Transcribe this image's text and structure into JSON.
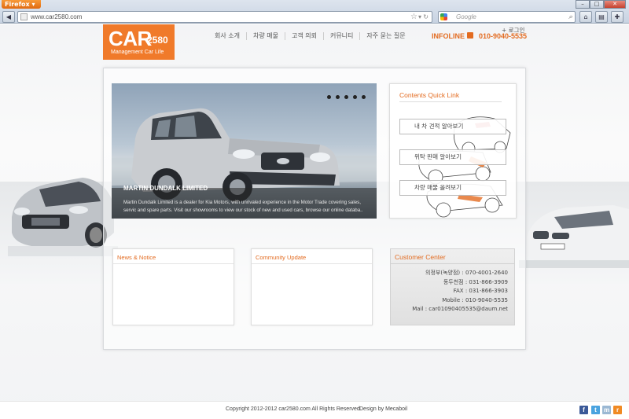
{
  "browser": {
    "app_button": "Firefox",
    "url": "www.car2580.com",
    "search_placeholder": "Google"
  },
  "header": {
    "logo_main": "CAR",
    "logo_num": "2580",
    "logo_sub": "Management Car Life",
    "login": "+ 로그인",
    "nav": [
      "회사 소개",
      "차량 매물",
      "고객 의뢰",
      "커뮤니티",
      "자주 묻는 질문"
    ],
    "infoline_label": "INFOLINE",
    "infoline_phone": "010-9040-5535"
  },
  "hero": {
    "title": "MARTIN DUNDALK LIMITED",
    "text": "Martin Dundalk Limited is a dealer for Kia Motors, with unrivaled experience in the Motor Trade covering sales, servic and spare parts.  Visit our showrooms to view our stock of new and used cars, browse our online databa.."
  },
  "quick_link": {
    "title": "Contents Quick Link",
    "buttons": [
      "내 차 견적 알아보기",
      "위탁 판매 알아보기",
      "차량 매물 올려보기"
    ]
  },
  "boards": {
    "news_title": "News & Notice",
    "community_title": "Community Update"
  },
  "customer_center": {
    "title": "Customer Center",
    "rows": [
      "의정부(녹양점) : 070-4001-2640",
      "동두천점 : 031-866-3909",
      "FAX : 031-866-3903",
      "Mobile : 010-9040-5535",
      "Mail : car01090405535@daum.net"
    ]
  },
  "footer": {
    "copyright": "Copyright 2012-2012 car2580.com All Rights Reserved.",
    "design": "Design by Mecaboil"
  },
  "colors": {
    "accent": "#f07a2a",
    "accent_text": "#e36b20"
  }
}
